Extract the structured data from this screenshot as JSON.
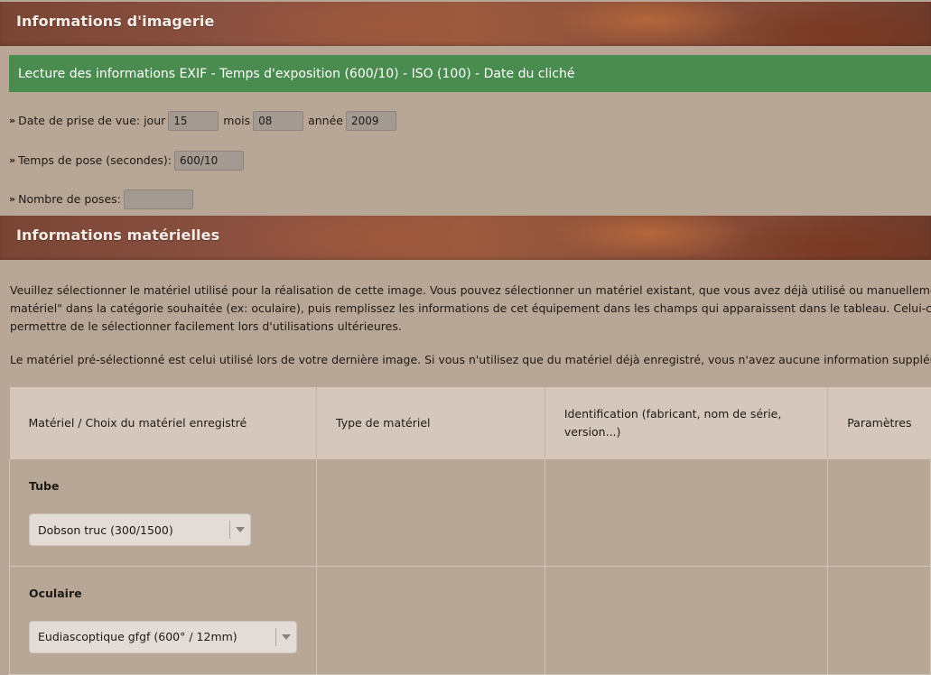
{
  "sections": {
    "imagery_title": "Informations d'imagerie",
    "hardware_title": "Informations matérielles"
  },
  "exif_bar": "Lecture des informations EXIF - Temps d'exposition (600/10) - ISO (100) - Date du cliché",
  "date": {
    "label": "Date de prise de vue: jour",
    "day": "15",
    "month_label": "mois",
    "month": "08",
    "year_label": "année",
    "year": "2009"
  },
  "exposure": {
    "label": "Temps de pose (secondes):",
    "value": "600/10"
  },
  "poses": {
    "label": "Nombre de poses:",
    "value": ""
  },
  "intro": {
    "line1": "Veuillez sélectionner le matériel utilisé pour la réalisation de cette image. Vous pouvez sélectionner un matériel existant, que vous avez déjà utilisé ou manuellement enregist",
    "line2": "matériel\" dans la catégorie souhaitée (ex: oculaire), puis remplissez les informations de cet équipement dans les champs qui apparaissent dans le tableau. Celui-ci sera ensuite",
    "line3": "permettre de le sélectionner facilement lors d'utilisations ultérieures.",
    "line4": "Le matériel pré-sélectionné est celui utilisé lors de votre dernière image. Si vous n'utilisez que du matériel déjà enregistré, vous n'avez aucune information supplémentaire à aj"
  },
  "table": {
    "headers": [
      "Matériel / Choix du matériel enregistré",
      "Type de matériel",
      "Identification (fabricant, nom de série, version...)",
      "Paramètres"
    ],
    "rows": [
      {
        "category": "Tube",
        "selected": "Dobson truc (300/1500)"
      },
      {
        "category": "Oculaire",
        "selected": "Eudiascoptique gfgf (600° / 12mm)"
      }
    ]
  },
  "colors": {
    "background": "#b8a696",
    "exif_bar": "#4a8c4f",
    "table_header": "#d5c7bb"
  }
}
